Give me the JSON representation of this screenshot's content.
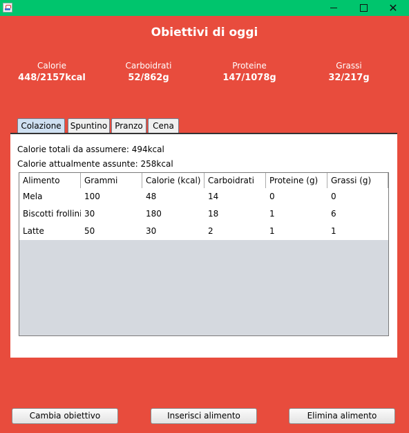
{
  "window": {
    "title": ""
  },
  "page_title": "Obiettivi di oggi",
  "metrics": [
    {
      "label": "Calorie",
      "value": "448/2157kcal"
    },
    {
      "label": "Carboidrati",
      "value": "52/862g"
    },
    {
      "label": "Proteine",
      "value": "147/1078g"
    },
    {
      "label": "Grassi",
      "value": "32/217g"
    }
  ],
  "tabs": [
    {
      "label": "Colazione",
      "active": true
    },
    {
      "label": "Spuntino",
      "active": false
    },
    {
      "label": "Pranzo",
      "active": false
    },
    {
      "label": "Cena",
      "active": false
    }
  ],
  "info": {
    "total": "Calorie totali da assumere: 494kcal",
    "current": "Calorie attualmente assunte: 258kcal"
  },
  "table": {
    "columns": [
      "Alimento",
      "Grammi",
      "Calorie (kcal)",
      "Carboidrati (g)",
      "Proteine (g)",
      "Grassi (g)"
    ],
    "rows": [
      [
        "Mela",
        "100",
        "48",
        "14",
        "0",
        "0"
      ],
      [
        "Biscotti frollini",
        "30",
        "180",
        "18",
        "1",
        "6"
      ],
      [
        "Latte",
        "50",
        "30",
        "2",
        "1",
        "1"
      ]
    ]
  },
  "buttons": {
    "change_goal": "Cambia obiettivo",
    "insert_food": "Inserisci alimento",
    "delete_food": "Elimina alimento"
  },
  "colors": {
    "background": "#e84c3d",
    "titlebar": "#00c56d",
    "active_tab": "#cfe0f2"
  }
}
